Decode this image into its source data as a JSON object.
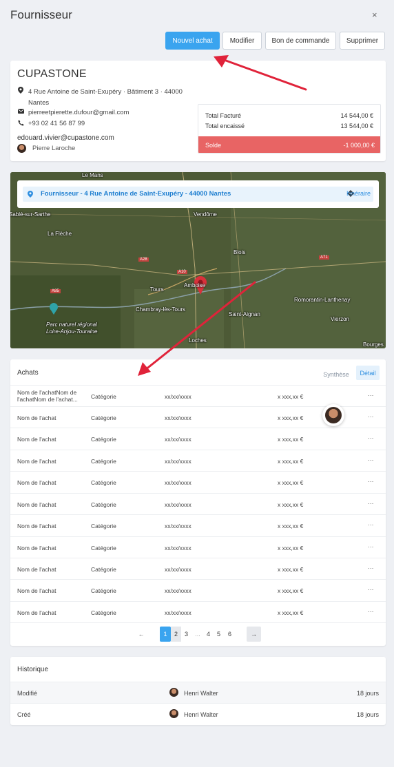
{
  "header": {
    "title": "Fournisseur",
    "close": "×"
  },
  "actions": {
    "new_purchase": "Nouvel achat",
    "edit": "Modifier",
    "order_form": "Bon de commande",
    "delete": "Supprimer"
  },
  "supplier": {
    "name": "CUPASTONE",
    "address_line1": "4 Rue Antoine de Saint-Exupéry · Bâtiment 3 · 44000",
    "address_line2": "Nantes",
    "email": "pierreetpierette.dufour@gmail.com",
    "phone": "+93 02 41 56 87 99",
    "contact_email": "edouard.vivier@cupastone.com",
    "contact_name": "Pierre Laroche"
  },
  "finance": {
    "billed_label": "Total Facturé",
    "billed_value": "14 544,00 €",
    "collected_label": "Total encaissé",
    "collected_value": "13 544,00 €",
    "balance_label": "Solde",
    "balance_value": "-1 000,00 €",
    "balance_color": "#e86464"
  },
  "map": {
    "location": "Fournisseur - 4 Rue Antoine de Saint-Exupéry - 44000 Nantes",
    "route": "Itinéraire",
    "labels": [
      "Le Mans",
      "Vendôme",
      "La Flèche",
      "Blois",
      "Tours",
      "Amboise",
      "Chambray-lès-Tours",
      "Romorantin-Lanthenay",
      "Saint-Aignan",
      "Vierzon",
      "Loches",
      "Bourges",
      "Parc naturel régional",
      "Loire-Anjou-Touraine",
      "Sablé-sur-Sarthe",
      "A28",
      "A10",
      "A71",
      "A85"
    ]
  },
  "purchases": {
    "title": "Achats",
    "view_summary": "Synthèse",
    "view_detail": "Détail",
    "rows": [
      {
        "name": "Nom de l'achatNom de l'achatNom de l'achat...",
        "category": "Catégorie",
        "date": "xx/xx/xxxx",
        "amount": "x xxx,xx €",
        "more": "···"
      },
      {
        "name": "Nom de l'achat",
        "category": "Catégorie",
        "date": "xx/xx/xxxx",
        "amount": "x xxx,xx €",
        "more": "···"
      },
      {
        "name": "Nom de l'achat",
        "category": "Catégorie",
        "date": "xx/xx/xxxx",
        "amount": "x xxx,xx €",
        "more": "···"
      },
      {
        "name": "Nom de l'achat",
        "category": "Catégorie",
        "date": "xx/xx/xxxx",
        "amount": "x xxx,xx €",
        "more": "···"
      },
      {
        "name": "Nom de l'achat",
        "category": "Catégorie",
        "date": "xx/xx/xxxx",
        "amount": "x xxx,xx €",
        "more": "···"
      },
      {
        "name": "Nom de l'achat",
        "category": "Catégorie",
        "date": "xx/xx/xxxx",
        "amount": "x xxx,xx €",
        "more": "···"
      },
      {
        "name": "Nom de l'achat",
        "category": "Catégorie",
        "date": "xx/xx/xxxx",
        "amount": "x xxx,xx €",
        "more": "···"
      },
      {
        "name": "Nom de l'achat",
        "category": "Catégorie",
        "date": "xx/xx/xxxx",
        "amount": "x xxx,xx €",
        "more": "···"
      },
      {
        "name": "Nom de l'achat",
        "category": "Catégorie",
        "date": "xx/xx/xxxx",
        "amount": "x xxx,xx €",
        "more": "···"
      },
      {
        "name": "Nom de l'achat",
        "category": "Catégorie",
        "date": "xx/xx/xxxx",
        "amount": "x xxx,xx €",
        "more": "···"
      },
      {
        "name": "Nom de l'achat",
        "category": "Catégorie",
        "date": "xx/xx/xxxx",
        "amount": "x xxx,xx €",
        "more": "···"
      }
    ]
  },
  "pagination": {
    "prev": "←",
    "pages": [
      "1",
      "2",
      "3",
      "...",
      "4",
      "5",
      "6"
    ],
    "current": "1",
    "next": "→"
  },
  "history": {
    "title": "Historique",
    "rows": [
      {
        "action": "Modifié",
        "user": "Henri Walter",
        "when": "18 jours"
      },
      {
        "action": "Créé",
        "user": "Henri Walter",
        "when": "18 jours"
      }
    ]
  },
  "colors": {
    "accent": "#3aa4ef",
    "danger": "#e86464",
    "annotation_arrow": "#e0233a"
  }
}
